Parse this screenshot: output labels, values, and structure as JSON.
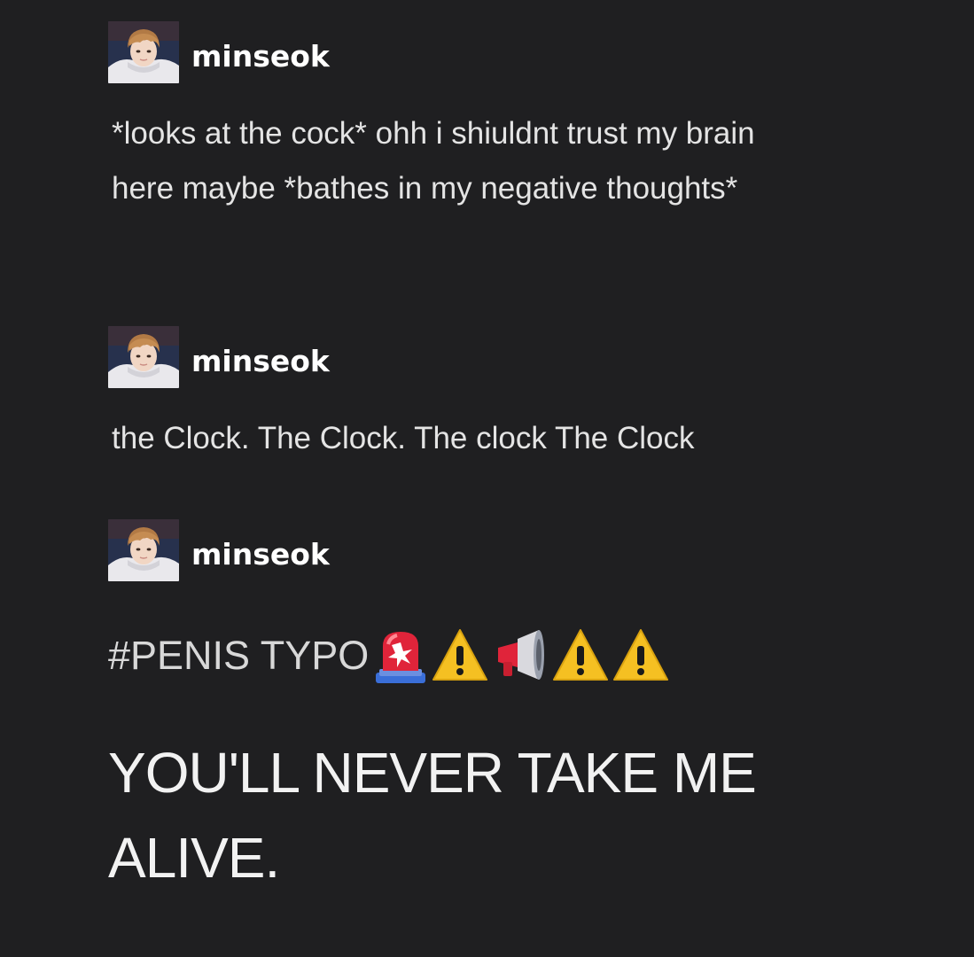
{
  "posts": [
    {
      "username": "minseok",
      "text": "*looks at the cock* ohh  i shiuldnt trust my brain here maybe *bathes in my negative thoughts*"
    },
    {
      "username": "minseok",
      "text": "the Clock. The Clock. The clock The Clock"
    },
    {
      "username": "minseok",
      "tag": "#PENIS TYPO",
      "emojis": [
        "rotating-light-icon",
        "warning-icon",
        "megaphone-icon",
        "warning-icon",
        "warning-icon"
      ],
      "text": "YOU'LL NEVER TAKE ME ALIVE."
    }
  ],
  "colors": {
    "background": "#1f1f21",
    "username": "#ffffff",
    "body_text": "#e4e4e4",
    "warning_yellow": "#f5c022",
    "siren_red": "#e0243a"
  }
}
